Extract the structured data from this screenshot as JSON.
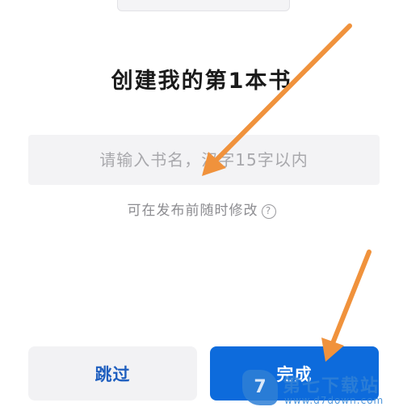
{
  "title": "创建我的第1本书",
  "book_name": {
    "value": "",
    "placeholder": "请输入书名，汉字15字以内"
  },
  "hint": "可在发布前随时修改",
  "help_icon": "question-circle-icon",
  "buttons": {
    "skip": "跳过",
    "done": "完成"
  },
  "watermark": {
    "logo_icon": "d7-logo-icon",
    "logo_text": "7",
    "name": "第七下载站",
    "url": "www.d7down.com"
  },
  "colors": {
    "primary": "#0d6bdc",
    "skip_text": "#1f5fbf",
    "arrow": "#f0923c"
  }
}
